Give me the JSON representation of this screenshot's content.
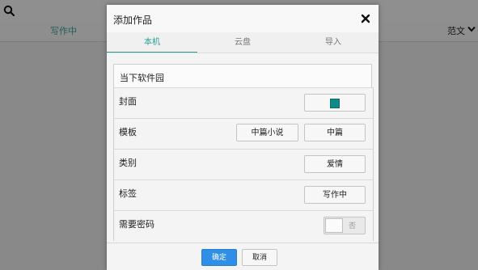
{
  "background": {
    "tabs": {
      "writing": "写作中",
      "fanwen": "范文"
    },
    "icons": {
      "search": "search-icon",
      "dropdown": "chevron-down-icon"
    }
  },
  "dialog": {
    "title": "添加作品",
    "close_icon": "close-icon",
    "tabs": [
      {
        "label": "本机",
        "active": true
      },
      {
        "label": "云盘",
        "active": false
      },
      {
        "label": "导入",
        "active": false
      }
    ],
    "document_name": "当下软件园",
    "rows": {
      "cover": {
        "label": "封面",
        "swatch_color": "#0f8a86"
      },
      "template": {
        "label": "模板",
        "options": [
          "中篇小说",
          "中篇"
        ]
      },
      "category": {
        "label": "类别",
        "value": "爱情"
      },
      "tag": {
        "label": "标签",
        "value": "写作中"
      },
      "password": {
        "label": "需要密码",
        "toggle_text": "否",
        "enabled": false
      }
    },
    "footer": {
      "ok": "确定",
      "cancel": "取消"
    }
  },
  "colors": {
    "accent": "#2a9d8f",
    "primary_button": "#2f8ee6"
  }
}
